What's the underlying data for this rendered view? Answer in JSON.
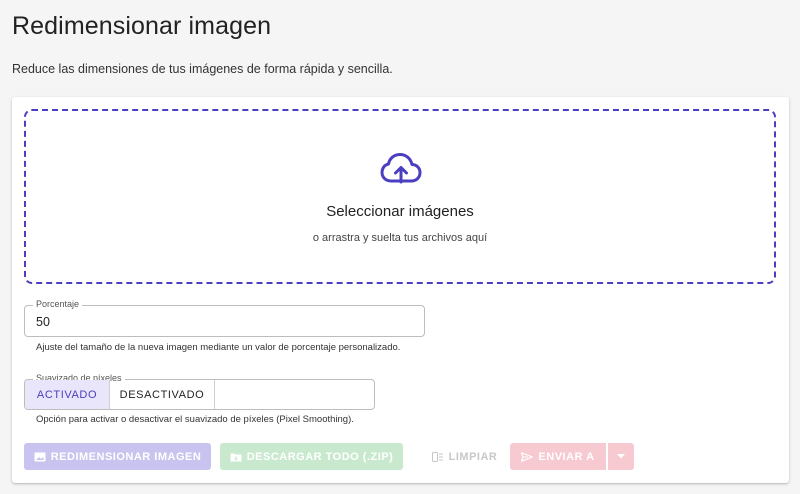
{
  "header": {
    "title": "Redimensionar imagen",
    "subtitle": "Reduce las dimensiones de tus imágenes de forma rápida y sencilla."
  },
  "dropzone": {
    "icon": "cloud-upload-icon",
    "title": "Seleccionar imágenes",
    "subtitle": "o arrastra y suelta tus archivos aquí"
  },
  "percentage": {
    "label": "Porcentaje",
    "value": "50",
    "helper": "Ajuste del tamaño de la nueva imagen mediante un valor de porcentaje personalizado."
  },
  "smoothing": {
    "label": "Suavizado de píxeles",
    "options": [
      "ACTIVADO",
      "DESACTIVADO"
    ],
    "selected": "ACTIVADO",
    "helper": "Opción para activar o desactivar el suavizado de píxeles (Pixel Smoothing)."
  },
  "actions": {
    "resize_label": "REDIMENSIONAR IMAGEN",
    "download_label": "DESCARGAR TODO (.ZIP)",
    "clear_label": "LIMPIAR",
    "send_label": "ENVIAR A"
  },
  "colors": {
    "accent": "#4a3fc0",
    "resize_disabled": "#c8c4ef",
    "download_disabled": "#c9e9cf",
    "send_disabled": "#f7c9d1"
  }
}
